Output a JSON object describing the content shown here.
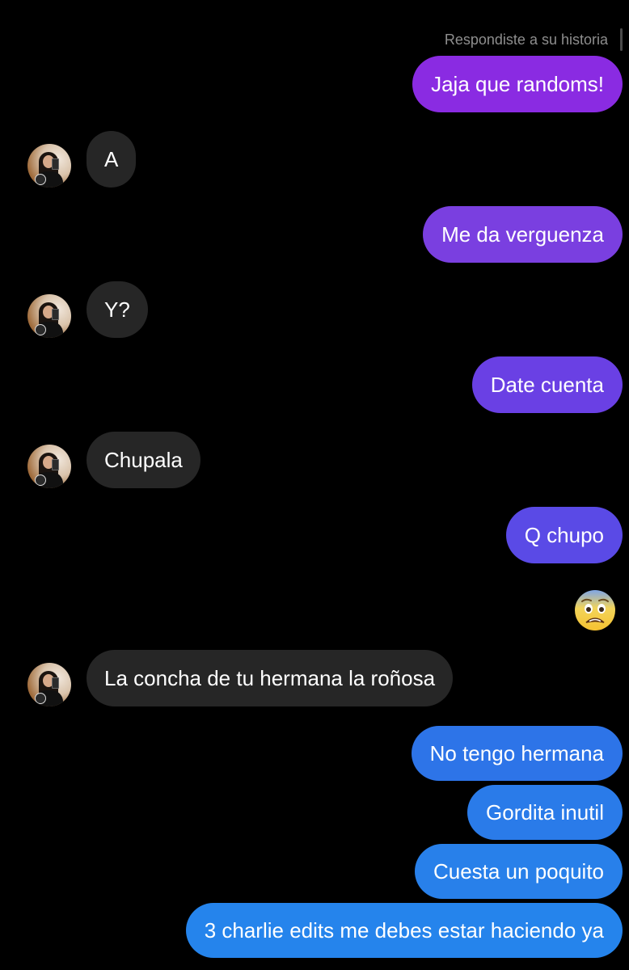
{
  "thread": {
    "reply_note": "Respondiste a su historia",
    "messages": [
      {
        "from": "me",
        "text": "Jaja que randoms!"
      },
      {
        "from": "them",
        "text": "A"
      },
      {
        "from": "me",
        "text": "Me da verguenza"
      },
      {
        "from": "them",
        "text": "Y?"
      },
      {
        "from": "me",
        "text": "Date cuenta"
      },
      {
        "from": "them",
        "text": "Chupala"
      },
      {
        "from": "me",
        "text": "Q chupo"
      },
      {
        "from": "me",
        "emoji": "fearful-face-icon"
      },
      {
        "from": "them",
        "text": "La concha de tu hermana la roñosa"
      },
      {
        "from": "me",
        "text": "No tengo hermana"
      },
      {
        "from": "me",
        "text": "Gordita inutil"
      },
      {
        "from": "me",
        "text": "Cuesta un poquito"
      },
      {
        "from": "me",
        "text": "3 charlie edits me debes estar haciendo ya"
      }
    ]
  },
  "colors": {
    "background": "#000000",
    "received_bubble": "#262626",
    "sent_gradient": [
      "#8a2be2",
      "#7a3fe0",
      "#6a40e4",
      "#5a4ae6",
      "#4f52e6",
      "#2d74e8",
      "#2a7be9",
      "#2880ea",
      "#2584ec"
    ]
  },
  "icons": {
    "avatar": "contact-avatar",
    "emoji": "fearful-face-icon"
  }
}
